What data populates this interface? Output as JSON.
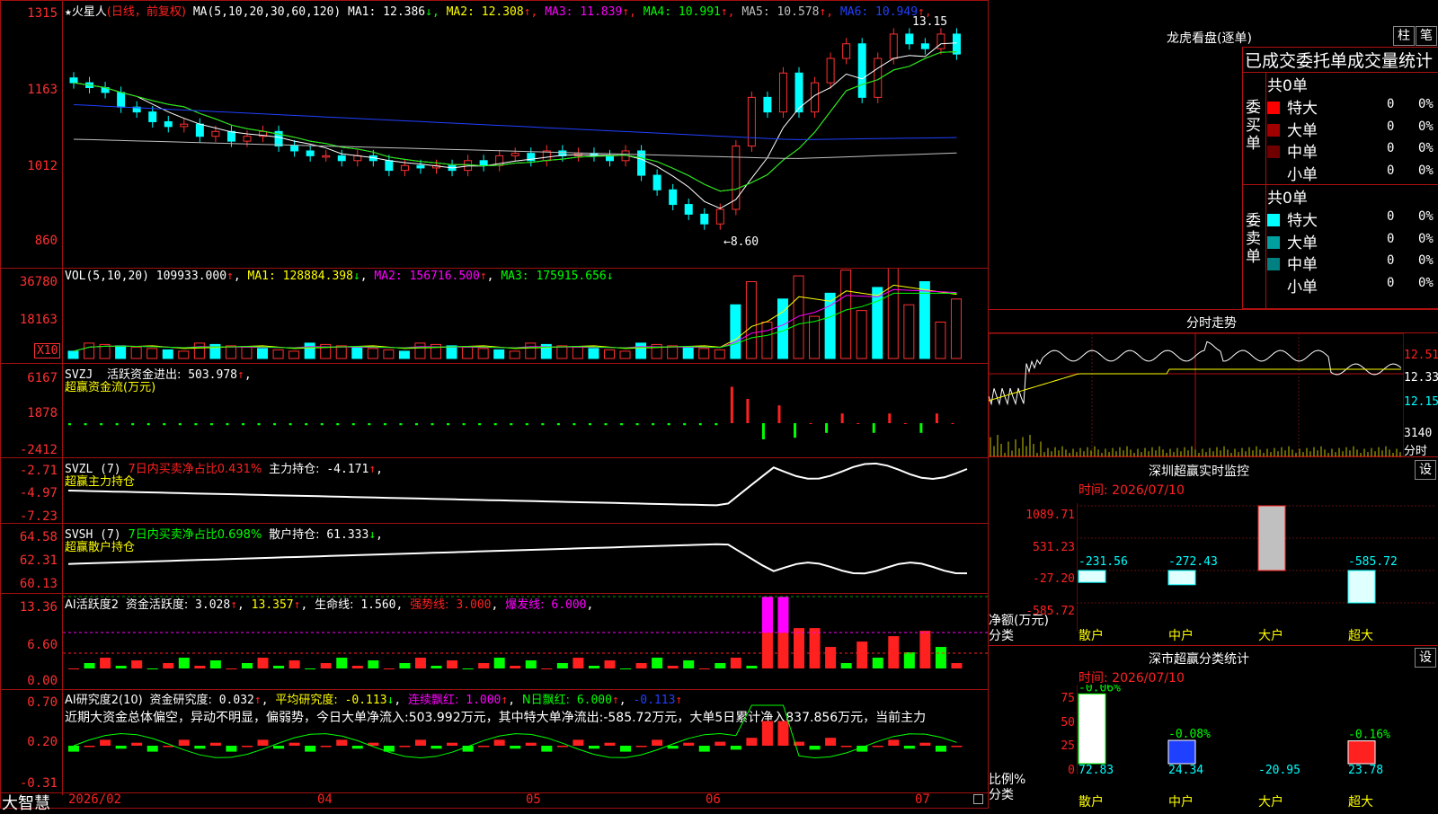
{
  "stock": {
    "name": "火星人",
    "period_label": "(日线，前复权)",
    "ma_label": "MA(5,10,20,30,60,120)"
  },
  "main": {
    "ma": [
      {
        "label": "MA1:",
        "value": "12.386",
        "arrow": "↓",
        "color": "#ffffff"
      },
      {
        "label": "MA2:",
        "value": "12.308",
        "arrow": "↑",
        "color": "#ffff00"
      },
      {
        "label": "MA3:",
        "value": "11.839",
        "arrow": "↑",
        "color": "#ff00ff"
      },
      {
        "label": "MA4:",
        "value": "10.991",
        "arrow": "↑",
        "color": "#00ff00"
      },
      {
        "label": "MA5:",
        "value": "10.578",
        "arrow": "↑",
        "color": "#c0c0c0"
      },
      {
        "label": "MA6:",
        "value": "10.949",
        "arrow": "↑",
        "color": "#2040ff"
      }
    ],
    "yticks": [
      "1315",
      "1163",
      "1012",
      "860"
    ],
    "high_label": "13.15",
    "low_label": "←8.60"
  },
  "vol": {
    "title": "VOL(5,10,20)",
    "value": "109933.000",
    "ma1": "128884.398",
    "ma2": "156716.500",
    "ma3": "175915.656",
    "yticks": [
      "36780",
      "18163"
    ],
    "unit": "X10"
  },
  "svzj": {
    "title": "SVZJ",
    "label": "活跃资金进出:",
    "value": "503.978",
    "sub": "超赢资金流(万元)",
    "yticks": [
      "6167",
      "1878",
      "-2412"
    ]
  },
  "svzl": {
    "title": "SVZL (7)",
    "label1": "7日内买卖净占比0.431%",
    "label2": "主力持仓:",
    "value": "-4.171",
    "sub": "超赢主力持仓",
    "yticks": [
      "-2.71",
      "-4.97",
      "-7.23"
    ]
  },
  "svsh": {
    "title": "SVSH (7)",
    "label1": "7日内买卖净占比0.698%",
    "label2": "散户持仓:",
    "value": "61.333",
    "sub": "超赢散户持仓",
    "yticks": [
      "64.58",
      "62.31",
      "60.13"
    ]
  },
  "ai1": {
    "title": "AI活跃度2",
    "l1": "资金活跃度:",
    "v1": "3.028",
    "v2": "13.357",
    "l3": "生命线:",
    "v3": "1.560",
    "l4": "强势线:",
    "v4": "3.000",
    "l5": "爆发线:",
    "v5": "6.000",
    "yticks": [
      "13.36",
      "6.60",
      "0.00"
    ]
  },
  "ai2": {
    "title": "AI研究度2(10)",
    "l1": "资金研究度:",
    "v1": "0.032",
    "l2": "平均研究度:",
    "v2": "-0.113",
    "l3": "连续飘红:",
    "v3": "1.000",
    "l4": "N日飘红:",
    "v4": "6.000",
    "v5": "-0.113",
    "comment": "近期大资金总体偏空，异动不明显，偏弱势，今日大单净流入:503.992万元，其中特大单净流出:-585.72万元，大单5日累计净入837.856万元，当前主力",
    "yticks": [
      "0.70",
      "0.20",
      "-0.31"
    ]
  },
  "xaxis": {
    "brand": "大智慧",
    "labels": [
      "2026/02",
      "04",
      "05",
      "06",
      "07"
    ]
  },
  "right": {
    "lhb_title": "龙虎看盘(逐单)",
    "btn_bar": "柱",
    "btn_pen": "笔",
    "stats_header": "已成交委托单成交量统计",
    "buy_side": "委买单",
    "sell_side": "委卖单",
    "buy_total": "共0单",
    "sell_total": "共0单",
    "buy_rows": [
      {
        "label": "特大",
        "count": "0",
        "pct": "0%",
        "color": "#ff0000"
      },
      {
        "label": "大单",
        "count": "0",
        "pct": "0%",
        "color": "#a00000"
      },
      {
        "label": "中单",
        "count": "0",
        "pct": "0%",
        "color": "#700000"
      },
      {
        "label": "小单",
        "count": "0",
        "pct": "0%",
        "color": "#000000"
      }
    ],
    "sell_rows": [
      {
        "label": "特大",
        "count": "0",
        "pct": "0%",
        "color": "#00ffff"
      },
      {
        "label": "大单",
        "count": "0",
        "pct": "0%",
        "color": "#00a0a0"
      },
      {
        "label": "中单",
        "count": "0",
        "pct": "0%",
        "color": "#008080"
      },
      {
        "label": "小单",
        "count": "0",
        "pct": "0%",
        "color": "#000000"
      }
    ],
    "intraday_title": "分时走势",
    "intraday_prices": [
      "12.51",
      "12.33",
      "12.15"
    ],
    "intraday_vol": "3140",
    "intraday_vol_unit": "分时",
    "sz_title": "深圳超赢实时监控",
    "sz_btn": "设",
    "sz_time": "时间: 2026/07/10",
    "sz_yticks": [
      "1089.71",
      "531.23",
      "-27.20",
      "-585.72"
    ],
    "sz_ylabel": "净额(万元)",
    "sz_xlabel": "分类",
    "sz_cats": [
      "散户",
      "中户",
      "大户",
      "超大"
    ],
    "sz_values": [
      "-231.56",
      "-272.43",
      "1089.71",
      "-585.72"
    ],
    "ss_title": "深市超赢分类统计",
    "ss_btn": "设",
    "ss_time": "时间: 2026/07/10",
    "ss_yticks": [
      "75",
      "50",
      "25",
      "0"
    ],
    "ss_ylabel": "比例%",
    "ss_xlabel": "分类",
    "ss_pct": [
      "-0.06%",
      "-0.08%",
      "",
      "-0.16%"
    ],
    "ss_vals": [
      "72.83",
      "24.34",
      "-20.95",
      "23.78"
    ],
    "ss_cats": [
      "散户",
      "中户",
      "大户",
      "超大"
    ]
  },
  "chart_data": [
    {
      "type": "candlestick",
      "title": "火星人(日线，前复权)",
      "ylim": [
        8.0,
        13.5
      ],
      "high": 13.15,
      "low": 8.6,
      "x_labels": [
        "2026/02",
        "04",
        "05",
        "06",
        "07"
      ],
      "close": [
        11.8,
        11.7,
        11.6,
        11.3,
        11.2,
        11.0,
        10.9,
        10.95,
        10.7,
        10.8,
        10.6,
        10.7,
        10.8,
        10.5,
        10.4,
        10.3,
        10.3,
        10.2,
        10.3,
        10.2,
        10.0,
        10.1,
        10.05,
        10.1,
        10.0,
        10.2,
        10.1,
        10.3,
        10.35,
        10.2,
        10.4,
        10.3,
        10.35,
        10.3,
        10.2,
        10.4,
        9.9,
        9.6,
        9.3,
        9.1,
        8.9,
        9.2,
        10.5,
        11.5,
        11.2,
        12.0,
        11.2,
        11.8,
        12.3,
        12.6,
        11.5,
        12.3,
        12.8,
        12.6,
        12.5,
        12.8,
        12.39
      ]
    },
    {
      "type": "bar",
      "title": "VOL(5,10,20)",
      "series": [
        {
          "name": "MA1",
          "values": [
            128884.398
          ]
        },
        {
          "name": "MA2",
          "values": [
            156716.5
          ]
        },
        {
          "name": "MA3",
          "values": [
            175915.656
          ]
        }
      ]
    },
    {
      "type": "bar",
      "title": "深圳超赢实时监控",
      "categories": [
        "散户",
        "中户",
        "大户",
        "超大"
      ],
      "values": [
        -231.56,
        -272.43,
        1089.71,
        -585.72
      ],
      "ylim": [
        -585.72,
        1089.71
      ]
    },
    {
      "type": "bar",
      "title": "深市超赢分类统计",
      "categories": [
        "散户",
        "中户",
        "大户",
        "超大"
      ],
      "values": [
        72.83,
        24.34,
        -20.95,
        23.78
      ],
      "ylim": [
        0,
        75
      ]
    }
  ]
}
